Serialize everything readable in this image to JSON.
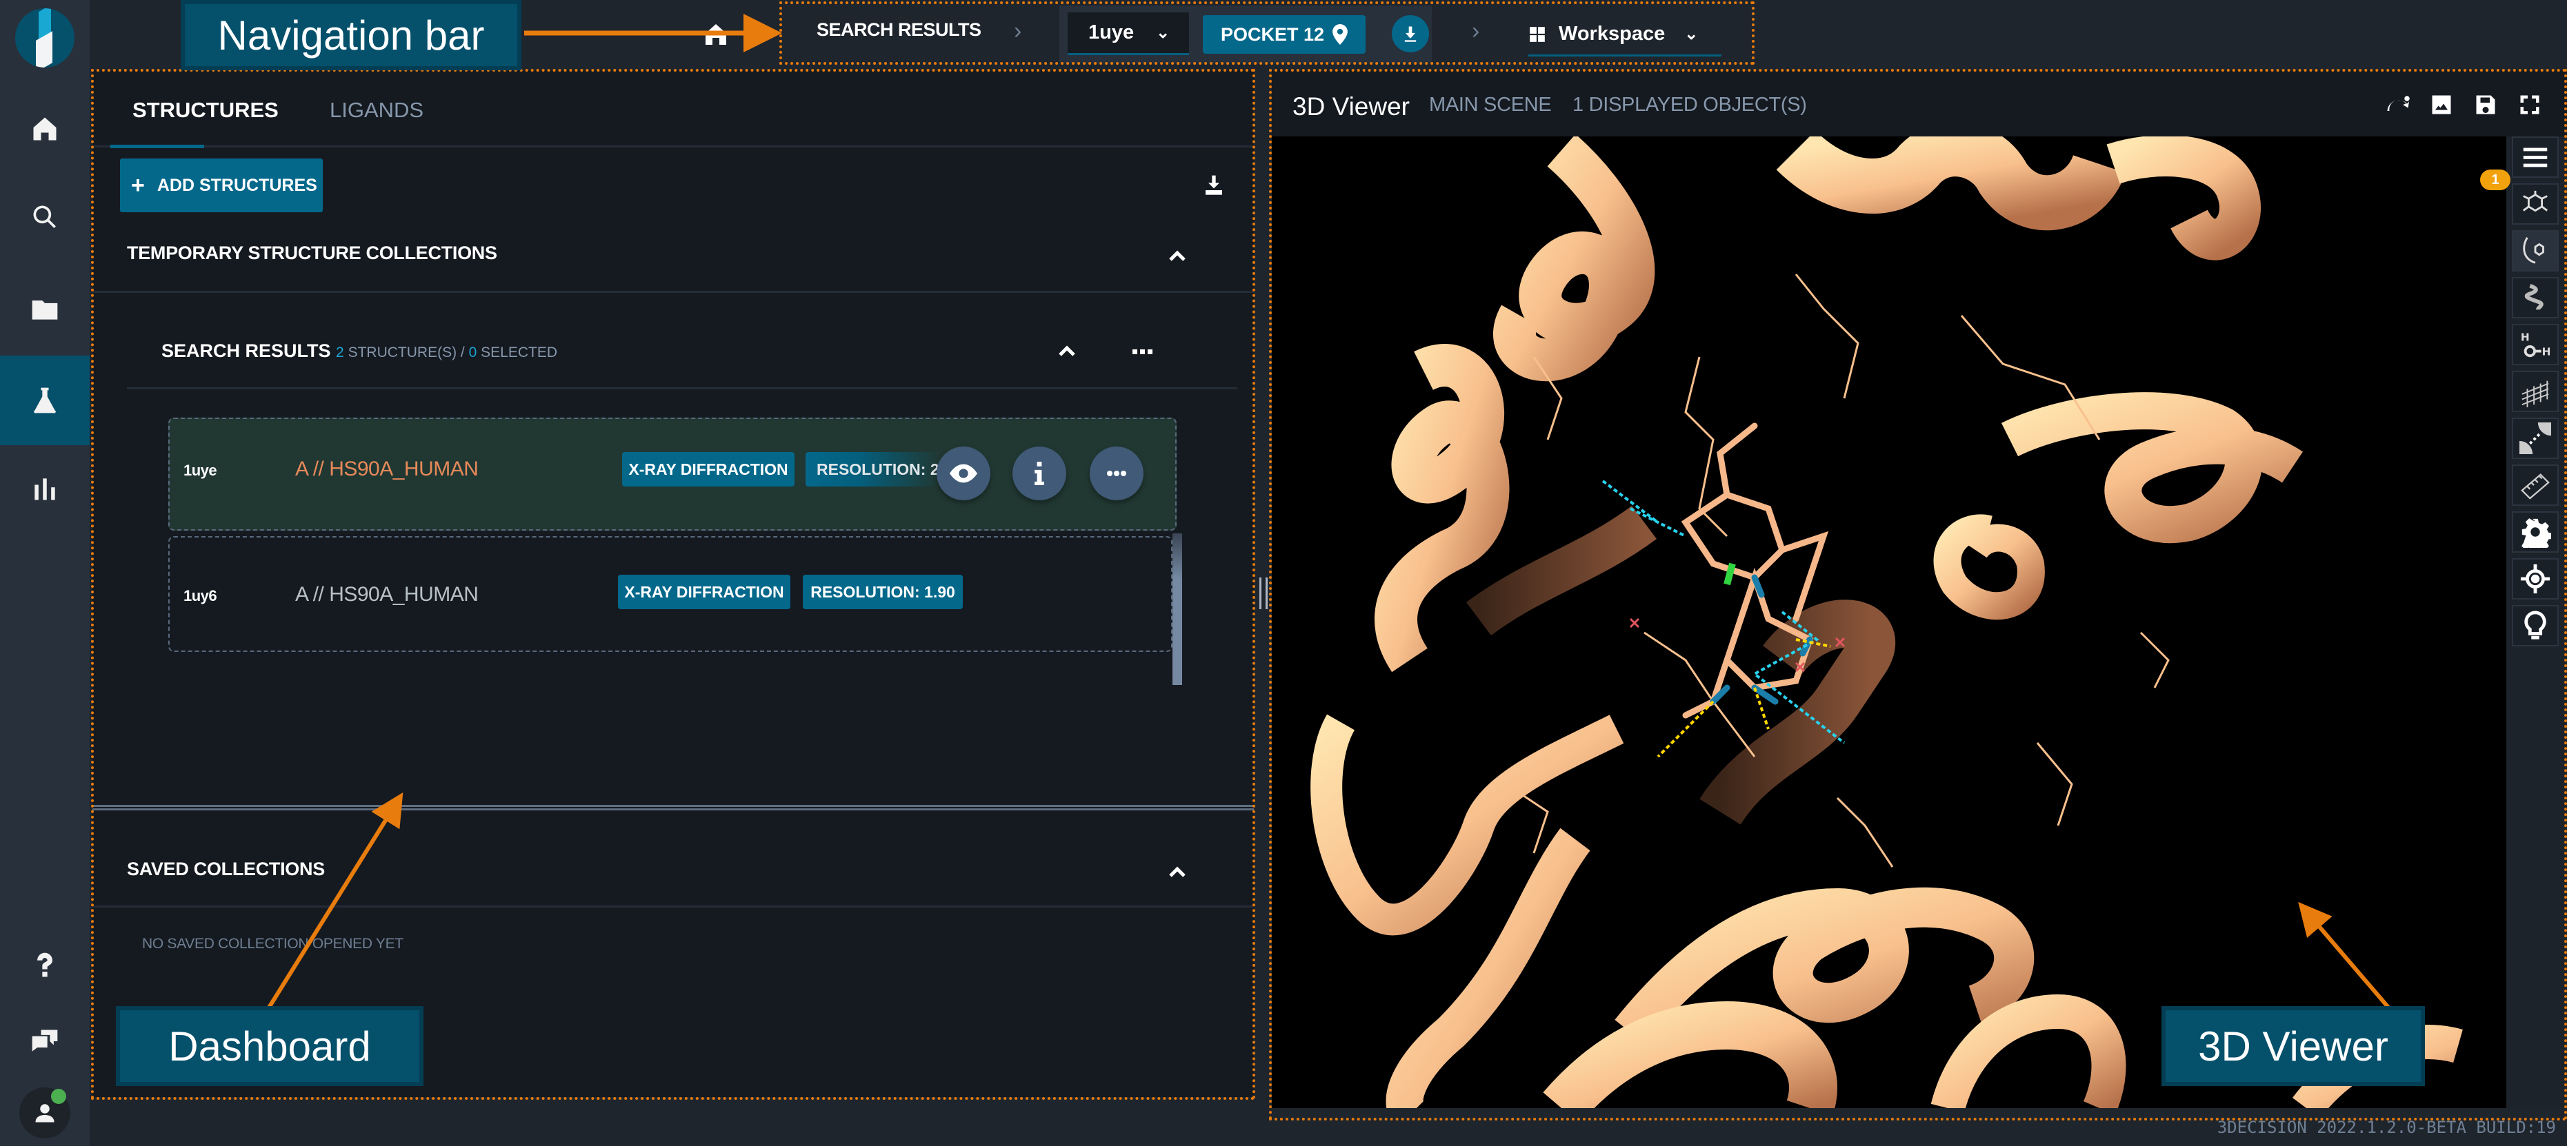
{
  "rail": {
    "items": [
      {
        "name": "home",
        "icon": "home-icon",
        "active": false
      },
      {
        "name": "search",
        "icon": "search-icon",
        "active": false
      },
      {
        "name": "projects",
        "icon": "folder-icon",
        "active": false
      },
      {
        "name": "workspace",
        "icon": "flask-icon",
        "active": true
      },
      {
        "name": "analytics",
        "icon": "bar-chart-icon",
        "active": false
      }
    ],
    "bottom_items": [
      {
        "name": "help",
        "icon": "question-icon"
      },
      {
        "name": "feedback",
        "icon": "chat-icon"
      },
      {
        "name": "user",
        "icon": "user-icon",
        "status": "online"
      }
    ]
  },
  "navbar": {
    "breadcrumb_root": "SEARCH RESULTS",
    "structure_select": "1uye",
    "pocket_label": "POCKET 12",
    "workspace_label": "Workspace"
  },
  "dashboard": {
    "tabs": [
      {
        "label": "STRUCTURES",
        "active": true
      },
      {
        "label": "LIGANDS",
        "active": false
      }
    ],
    "add_button": "ADD STRUCTURES",
    "temp_section": "TEMPORARY STRUCTURE COLLECTIONS",
    "search_results": {
      "title": "SEARCH RESULTS",
      "count": "2",
      "count_suffix": "STRUCTURE(S) /",
      "selected": "0",
      "selected_suffix": "SELECTED"
    },
    "rows": [
      {
        "id": "1uye",
        "name": "A // HS90A_HUMAN",
        "method": "X-RAY DIFFRACTION",
        "resolution": "RESOLUTION: 2.",
        "selected": true
      },
      {
        "id": "1uy6",
        "name": "A // HS90A_HUMAN",
        "method": "X-RAY DIFFRACTION",
        "resolution": "RESOLUTION: 1.90",
        "selected": false
      }
    ],
    "saved_section": "SAVED COLLECTIONS",
    "saved_empty": "NO SAVED COLLECTION OPENED YET"
  },
  "viewer": {
    "title": "3D Viewer",
    "scene": "MAIN SCENE",
    "objects": "1 DISPLAYED OBJECT(S)",
    "notification_count": "1",
    "side_tools": [
      "menu-icon",
      "ligand-icon",
      "ligand-chain-icon",
      "helix-icon",
      "water-icon",
      "surface-icon",
      "interaction-icon",
      "ruler-icon",
      "gear-icon",
      "target-icon",
      "lightbulb-icon"
    ]
  },
  "footer": {
    "version": "3DECISION 2022.1.2.0-BETA BUILD:19"
  },
  "annotations": {
    "navigation_bar": "Navigation bar",
    "dashboard": "Dashboard",
    "viewer": "3D Viewer",
    "color": "#e87c0d"
  },
  "colors": {
    "accent": "#04688b",
    "selected_row": "#213832",
    "protein": "#f8c08d",
    "ligand_name_highlight": "#e8895a"
  }
}
